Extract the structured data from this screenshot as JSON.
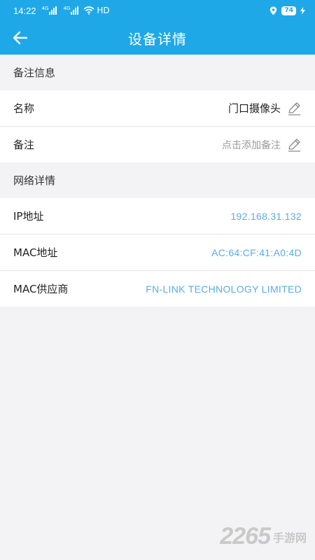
{
  "statusbar": {
    "time": "14:22",
    "signal1_label": "4G",
    "signal2_label": "4G",
    "network": "HD",
    "battery": "74"
  },
  "appbar": {
    "title": "设备详情"
  },
  "remark_section": {
    "header": "备注信息",
    "name_label": "名称",
    "name_value": "门口摄像头",
    "remark_label": "备注",
    "remark_placeholder": "点击添加备注"
  },
  "network_section": {
    "header": "网络详情",
    "ip_label": "IP地址",
    "ip_value": "192.168.31.132",
    "mac_label": "MAC地址",
    "mac_value": "AC:64:CF:41:A0:4D",
    "vendor_label": "MAC供应商",
    "vendor_value": "FN-LINK TECHNOLOGY LIMITED"
  },
  "watermark": {
    "number": "2265",
    "text": "手游网"
  },
  "colors": {
    "primary": "#1fa8e8",
    "link": "#5aace8",
    "background": "#f3f3f5"
  }
}
